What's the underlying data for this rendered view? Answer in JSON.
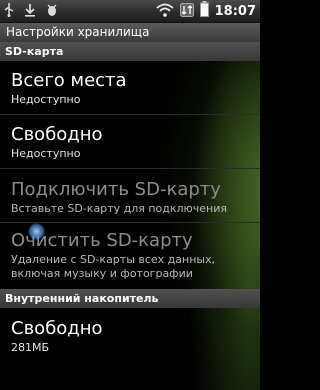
{
  "status_bar": {
    "time": "18:07",
    "left_icons": [
      "usb-icon",
      "sync-icon",
      "debug-icon"
    ],
    "right_icons": [
      "wifi-icon",
      "data-transfer-icon",
      "battery-icon"
    ]
  },
  "title": "Настройки хранилища",
  "sd_section": {
    "header": "SD-карта",
    "items": [
      {
        "title": "Всего места",
        "summary": "Недоступно",
        "enabled": true
      },
      {
        "title": "Свободно",
        "summary": "Недоступно",
        "enabled": true
      },
      {
        "title": "Подключить SD-карту",
        "summary": "Вставьте SD-карту для подключения",
        "enabled": false
      },
      {
        "title": "Очистить SD-карту",
        "summary": "Удаление с SD-карты всех данных, включая музыку и фотографии",
        "enabled": false
      }
    ]
  },
  "internal_section": {
    "header": "Внутренний накопитель",
    "items": [
      {
        "title": "Свободно",
        "summary": "281МБ",
        "enabled": true
      }
    ]
  },
  "colors": {
    "accent_glow": "#78aa3c",
    "disabled_text": "#8c8c8c"
  }
}
